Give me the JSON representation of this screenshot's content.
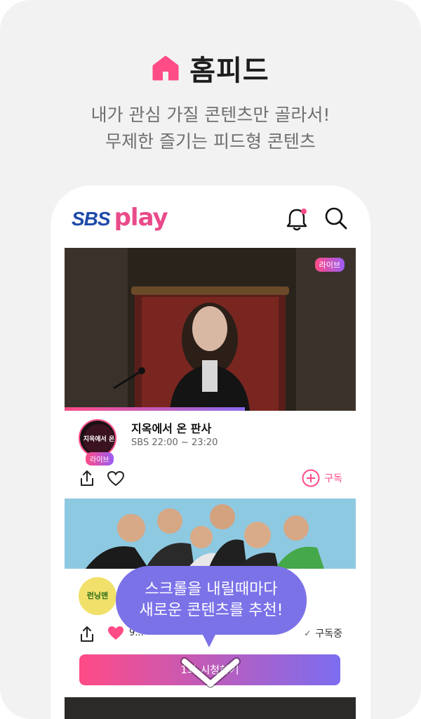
{
  "colors": {
    "accent": "#ff4b86",
    "bubble": "#7b72e8",
    "brand_blue": "#1f4aa8"
  },
  "hero": {
    "icon": "home-icon",
    "title": "홈피드",
    "subtitle_line1": "내가 관심 가질 콘텐츠만 골라서!",
    "subtitle_line2": "무제한 즐기는 피드형 콘텐츠"
  },
  "app": {
    "logo_sbs": "SBS",
    "logo_play": "play",
    "icons": [
      "bell-icon",
      "search-icon"
    ]
  },
  "feed": {
    "item1": {
      "badge": "라이브",
      "avatar_text": "지옥에서 온",
      "avatar_badge": "라이브",
      "title": "지옥에서 온 판사",
      "time": "SBS 22:00 ~ 23:20",
      "subscribe_label": "구독",
      "progress": 0.62
    },
    "item2": {
      "avatar_text": "런닝맨",
      "likes": "9...",
      "subscribed_label": "구독중",
      "watch_label": "1화 시청하기"
    }
  },
  "tooltip": {
    "line1": "스크롤을 내릴때마다",
    "line2": "새로운 콘텐츠를 추천!"
  }
}
